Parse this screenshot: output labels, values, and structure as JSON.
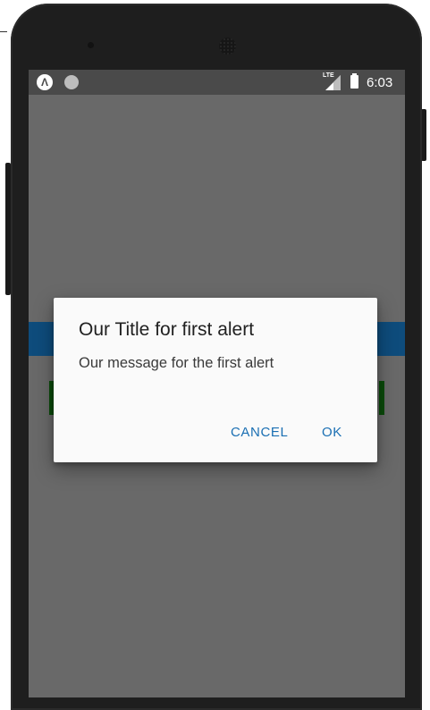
{
  "status_bar": {
    "left_icon": "Λ",
    "network_label": "LTE",
    "time": "6:03",
    "icons": [
      "app-notification-icon",
      "circle-notification-icon",
      "lte-signal-icon",
      "battery-icon"
    ]
  },
  "dialog": {
    "title": "Our Title for first alert",
    "message": "Our message for the first alert",
    "cancel_label": "CANCEL",
    "ok_label": "OK"
  },
  "colors": {
    "scrim": "#696969",
    "status_bar": "#4a4a4a",
    "accent": "#1a6fb3",
    "background_bar": "#0e4c7c",
    "background_button": "#0a4a0a"
  }
}
